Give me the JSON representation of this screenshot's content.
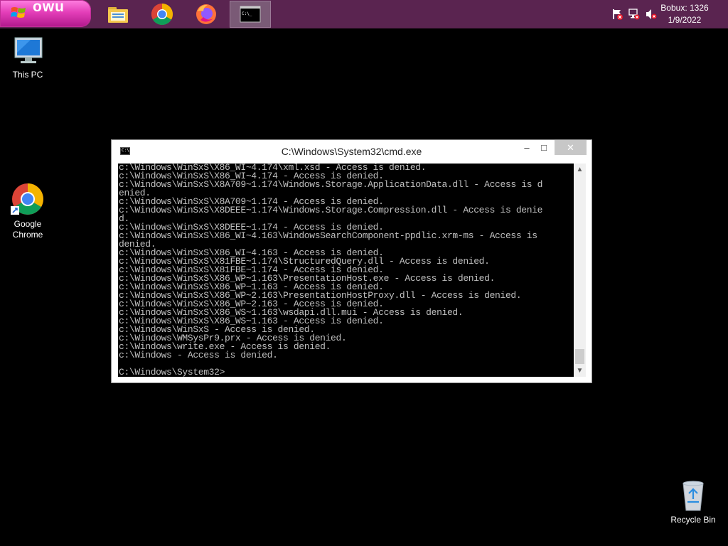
{
  "taskbar": {
    "start_label": "owu",
    "apps": [
      {
        "name": "file-explorer"
      },
      {
        "name": "google-chrome"
      },
      {
        "name": "firefox"
      },
      {
        "name": "command-prompt"
      }
    ],
    "clock_line1": "Bobux: 1326",
    "clock_line2": "1/9/2022"
  },
  "desktop": {
    "icons": [
      {
        "label": "This PC",
        "icon": "this-pc-icon"
      },
      {
        "label": "Google\nChrome",
        "icon": "chrome-icon"
      },
      {
        "label": "Recycle Bin",
        "icon": "recycle-bin-icon"
      }
    ]
  },
  "cmd_window": {
    "title": "C:\\Windows\\System32\\cmd.exe",
    "controls": {
      "minimize": "–",
      "maximize": "□",
      "close": "✕"
    },
    "output_lines": [
      "c:\\Windows\\WinSxS\\X86_WI~4.174\\xml.xsd - Access is denied.",
      "c:\\Windows\\WinSxS\\X86_WI~4.174 - Access is denied.",
      "c:\\Windows\\WinSxS\\X8A709~1.174\\Windows.Storage.ApplicationData.dll - Access is d",
      "enied.",
      "c:\\Windows\\WinSxS\\X8A709~1.174 - Access is denied.",
      "c:\\Windows\\WinSxS\\X8DEEE~1.174\\Windows.Storage.Compression.dll - Access is denie",
      "d.",
      "c:\\Windows\\WinSxS\\X8DEEE~1.174 - Access is denied.",
      "c:\\Windows\\WinSxS\\X86_WI~4.163\\WindowsSearchComponent-ppdlic.xrm-ms - Access is",
      "denied.",
      "c:\\Windows\\WinSxS\\X86_WI~4.163 - Access is denied.",
      "c:\\Windows\\WinSxS\\X81FBE~1.174\\StructuredQuery.dll - Access is denied.",
      "c:\\Windows\\WinSxS\\X81FBE~1.174 - Access is denied.",
      "c:\\Windows\\WinSxS\\X86_WP~1.163\\PresentationHost.exe - Access is denied.",
      "c:\\Windows\\WinSxS\\X86_WP~1.163 - Access is denied.",
      "c:\\Windows\\WinSxS\\X86_WP~2.163\\PresentationHostProxy.dll - Access is denied.",
      "c:\\Windows\\WinSxS\\X86_WP~2.163 - Access is denied.",
      "c:\\Windows\\WinSxS\\X86_WS~1.163\\wsdapi.dll.mui - Access is denied.",
      "c:\\Windows\\WinSxS\\X86_WS~1.163 - Access is denied.",
      "c:\\Windows\\WinSxS - Access is denied.",
      "c:\\Windows\\WMSysPr9.prx - Access is denied.",
      "c:\\Windows\\write.exe - Access is denied.",
      "c:\\Windows - Access is denied.",
      "",
      "C:\\Windows\\System32>"
    ]
  },
  "colors": {
    "taskbar": "#5a2450",
    "start_button": "#e43fb9",
    "desktop": "#000000",
    "console_bg": "#000000",
    "console_text": "#c0c0c0"
  }
}
